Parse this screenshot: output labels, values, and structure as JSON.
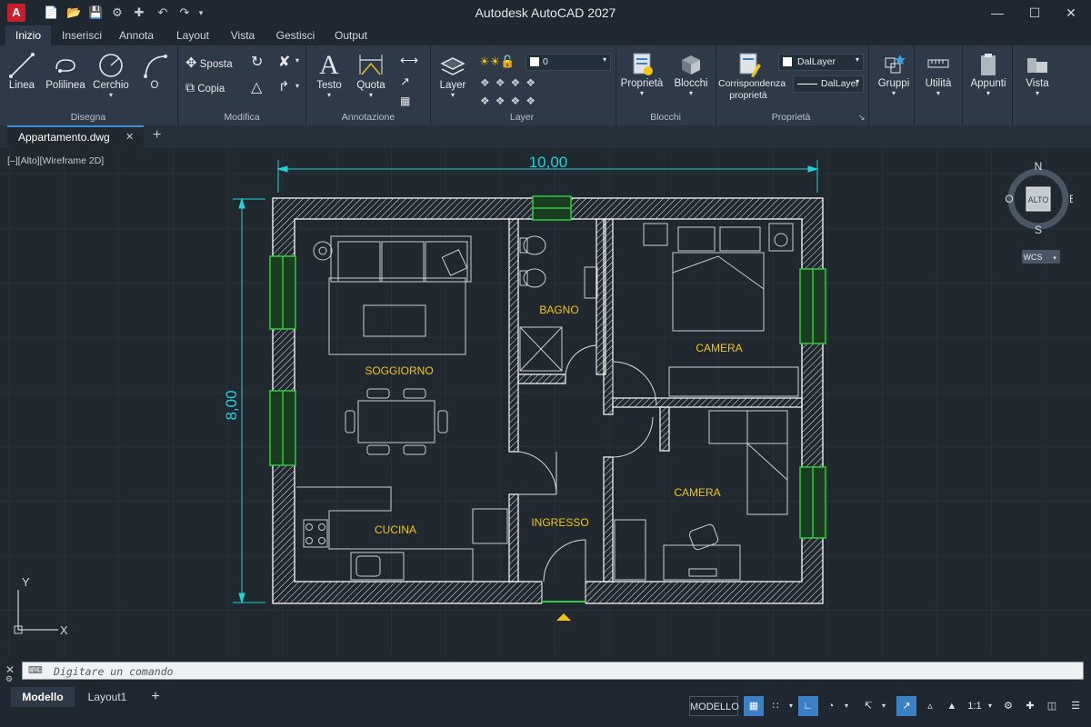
{
  "window": {
    "app_logo": "A",
    "title": "Autodesk AutoCAD 2027",
    "quick_access": [
      "new-icon",
      "open-icon",
      "save-icon",
      "web-save-icon",
      "share-icon",
      "undo-icon",
      "redo-icon",
      "dropdown-icon"
    ],
    "controls": {
      "minimize": "—",
      "maximize": "☐",
      "close": "✕"
    }
  },
  "ribbon_tabs": [
    "Inizio",
    "Inserisci",
    "Annota",
    "Layout",
    "Vista",
    "Gestisci",
    "Output"
  ],
  "active_tab": "Inizio",
  "ribbon": {
    "disegna": {
      "label": "Disegna",
      "tools": [
        "Linea",
        "Polilinea",
        "Cerchio",
        "O"
      ]
    },
    "modifica": {
      "label": "Modifica",
      "sposta": "Sposta",
      "copia": "Copia"
    },
    "annotazione": {
      "label": "Annotazione",
      "testo": "Testo",
      "quota": "Quota"
    },
    "layer": {
      "label": "Layer",
      "tool": "Layer",
      "current_layer": "0"
    },
    "blocchi": {
      "label": "Blocchi",
      "proprieta_tool": "Proprietà",
      "blocchi_tool": "Blocchi"
    },
    "proprieta": {
      "label": "Proprietà",
      "corrispondenza_line1": "Corrispondenza",
      "corrispondenza_line2": "proprietà",
      "color": "DalLayer",
      "linetype": "DalLayer"
    },
    "extra": [
      "Gruppi",
      "Utilità",
      "Appunti",
      "Vista"
    ]
  },
  "document_tab": {
    "name": "Appartamento.dwg",
    "close": "✕",
    "new_tab": "+"
  },
  "viewport": {
    "label": "[–][Alto][Wireframe 2D]",
    "viewcube": {
      "face": "ALTO",
      "n": "N",
      "s": "S",
      "e": "E",
      "o": "O",
      "ucs": "WCS"
    },
    "ucs_axis": {
      "x": "X",
      "y": "Y"
    }
  },
  "drawing": {
    "dim_horizontal": "10,00",
    "dim_vertical": "8,00",
    "rooms": [
      "SOGGIORNO",
      "BAGNO",
      "CAMERA",
      "CAMERA",
      "CUCINA",
      "INGRESSO"
    ],
    "colors": {
      "wall": "#ffffff",
      "furniture": "#c9ced4",
      "text": "#f2c511",
      "dimension": "#1fd3d6",
      "window": "#2ecc40"
    }
  },
  "command_line": {
    "placeholder": "Digitare un comando",
    "prompt_icon": "⌨"
  },
  "layout_tabs": [
    "Modello",
    "Layout1"
  ],
  "active_layout": "Modello",
  "status": {
    "modello": "MODELLO",
    "scale": "1:1"
  }
}
